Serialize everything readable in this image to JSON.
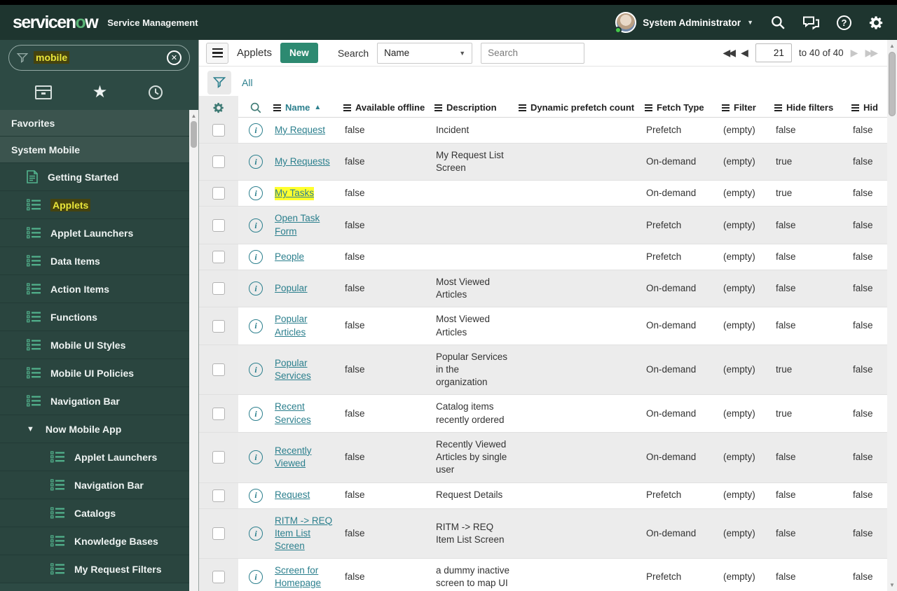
{
  "banner": {
    "logo_text_left": "servicen",
    "logo_o": "o",
    "logo_text_right": "w",
    "product": "Service Management",
    "user_name": "System Administrator"
  },
  "sidebar": {
    "search": {
      "value": "mobile"
    },
    "items": [
      {
        "type": "header",
        "label": "Favorites"
      },
      {
        "type": "header",
        "label": "System Mobile"
      },
      {
        "type": "item",
        "icon": "doc",
        "label": "Getting Started",
        "highlight": false
      },
      {
        "type": "item",
        "icon": "list",
        "label": "Applets",
        "highlight": true
      },
      {
        "type": "item",
        "icon": "list",
        "label": "Applet Launchers",
        "highlight": false
      },
      {
        "type": "item",
        "icon": "list",
        "label": "Data Items",
        "highlight": false
      },
      {
        "type": "item",
        "icon": "list",
        "label": "Action Items",
        "highlight": false
      },
      {
        "type": "item",
        "icon": "list",
        "label": "Functions",
        "highlight": false
      },
      {
        "type": "item",
        "icon": "list",
        "label": "Mobile UI Styles",
        "highlight": false
      },
      {
        "type": "item",
        "icon": "list",
        "label": "Mobile UI Policies",
        "highlight": false
      },
      {
        "type": "item",
        "icon": "list",
        "label": "Navigation Bar",
        "highlight": false
      },
      {
        "type": "toggle",
        "label": "Now Mobile App"
      },
      {
        "type": "subitem",
        "icon": "list",
        "label": "Applet Launchers",
        "highlight": false
      },
      {
        "type": "subitem",
        "icon": "list",
        "label": "Navigation Bar",
        "highlight": false
      },
      {
        "type": "subitem",
        "icon": "list",
        "label": "Catalogs",
        "highlight": false
      },
      {
        "type": "subitem",
        "icon": "list",
        "label": "Knowledge Bases",
        "highlight": false
      },
      {
        "type": "subitem",
        "icon": "list",
        "label": "My Request Filters",
        "highlight": false
      }
    ]
  },
  "toolbar": {
    "title": "Applets",
    "new_label": "New",
    "search_label": "Search",
    "search_field_selected": "Name",
    "search_placeholder": "Search",
    "pagination": {
      "current": "21",
      "range_text": "to 40 of 40"
    }
  },
  "filter_bar": {
    "all_label": "All"
  },
  "table": {
    "columns": [
      {
        "key": "name",
        "label": "Name",
        "sorted": true
      },
      {
        "key": "offline",
        "label": "Available offline",
        "sorted": false
      },
      {
        "key": "desc",
        "label": "Description",
        "sorted": false
      },
      {
        "key": "dynamic",
        "label": "Dynamic prefetch count",
        "sorted": false
      },
      {
        "key": "fetch",
        "label": "Fetch Type",
        "sorted": false
      },
      {
        "key": "filter",
        "label": "Filter",
        "sorted": false
      },
      {
        "key": "hidefilters",
        "label": "Hide filters",
        "sorted": false
      },
      {
        "key": "hid",
        "label": "Hid",
        "sorted": false
      }
    ],
    "rows": [
      {
        "name": "My Request",
        "offline": "false",
        "desc": "Incident",
        "dynamic": "",
        "fetch": "Prefetch",
        "filter": "(empty)",
        "hidefilters": "false",
        "hid": "false",
        "highlight": false
      },
      {
        "name": "My Requests",
        "offline": "false",
        "desc": "My Request List Screen",
        "dynamic": "",
        "fetch": "On-demand",
        "filter": "(empty)",
        "hidefilters": "true",
        "hid": "false",
        "highlight": false
      },
      {
        "name": "My Tasks",
        "offline": "false",
        "desc": "",
        "dynamic": "",
        "fetch": "On-demand",
        "filter": "(empty)",
        "hidefilters": "true",
        "hid": "false",
        "highlight": true
      },
      {
        "name": "Open Task Form",
        "offline": "false",
        "desc": "",
        "dynamic": "",
        "fetch": "Prefetch",
        "filter": "(empty)",
        "hidefilters": "false",
        "hid": "false",
        "highlight": false
      },
      {
        "name": "People",
        "offline": "false",
        "desc": "",
        "dynamic": "",
        "fetch": "Prefetch",
        "filter": "(empty)",
        "hidefilters": "false",
        "hid": "false",
        "highlight": false
      },
      {
        "name": "Popular",
        "offline": "false",
        "desc": "Most Viewed Articles",
        "dynamic": "",
        "fetch": "On-demand",
        "filter": "(empty)",
        "hidefilters": "false",
        "hid": "false",
        "highlight": false
      },
      {
        "name": "Popular Articles",
        "offline": "false",
        "desc": "Most Viewed Articles",
        "dynamic": "",
        "fetch": "On-demand",
        "filter": "(empty)",
        "hidefilters": "false",
        "hid": "false",
        "highlight": false
      },
      {
        "name": "Popular Services",
        "offline": "false",
        "desc": "Popular Services in the organization",
        "dynamic": "",
        "fetch": "On-demand",
        "filter": "(empty)",
        "hidefilters": "true",
        "hid": "false",
        "highlight": false
      },
      {
        "name": "Recent Services",
        "offline": "false",
        "desc": "Catalog items recently ordered",
        "dynamic": "",
        "fetch": "On-demand",
        "filter": "(empty)",
        "hidefilters": "true",
        "hid": "false",
        "highlight": false
      },
      {
        "name": "Recently Viewed",
        "offline": "false",
        "desc": "Recently Viewed Articles by single user",
        "dynamic": "",
        "fetch": "On-demand",
        "filter": "(empty)",
        "hidefilters": "false",
        "hid": "false",
        "highlight": false
      },
      {
        "name": "Request",
        "offline": "false",
        "desc": "Request Details",
        "dynamic": "",
        "fetch": "Prefetch",
        "filter": "(empty)",
        "hidefilters": "false",
        "hid": "false",
        "highlight": false
      },
      {
        "name": "RITM -> REQ Item List Screen",
        "offline": "false",
        "desc": "RITM -> REQ Item List Screen",
        "dynamic": "",
        "fetch": "On-demand",
        "filter": "(empty)",
        "hidefilters": "false",
        "hid": "false",
        "highlight": false
      },
      {
        "name": "Screen for Homepage",
        "offline": "false",
        "desc": "a dummy inactive screen to map UI",
        "dynamic": "",
        "fetch": "Prefetch",
        "filter": "(empty)",
        "hidefilters": "false",
        "hid": "false",
        "highlight": false
      }
    ]
  },
  "colors": {
    "banner_bg": "#1e352f",
    "sidebar_bg": "#2d4a44",
    "accent_teal": "#2b7f8d",
    "brand_green": "#53b48e",
    "new_button_bg": "#2d8a71",
    "highlight_yellow": "#ffff2e",
    "alt_row_bg": "#ececec"
  }
}
